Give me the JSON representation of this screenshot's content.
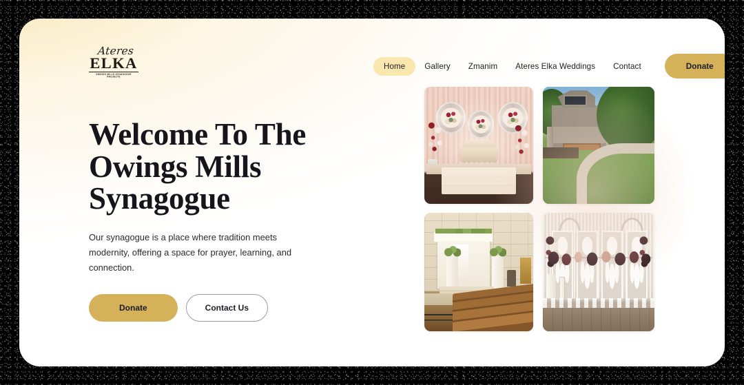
{
  "brand": {
    "script": "Ateres",
    "word": "ELKA",
    "subtitle": "OWINGS MILLS SYNAGOGUE PROJECTS"
  },
  "nav": {
    "items": [
      {
        "label": "Home",
        "active": true
      },
      {
        "label": "Gallery",
        "active": false
      },
      {
        "label": "Zmanim",
        "active": false
      },
      {
        "label": "Ateres Elka Weddings",
        "active": false
      },
      {
        "label": "Contact",
        "active": false
      }
    ],
    "donate_label": "Donate"
  },
  "hero": {
    "title": "Welcome To The Owings Mills Synagogue",
    "subtitle": "Our synagogue is a place where tradition meets modernity, offering a space for prayer, learning, and connection.",
    "primary_cta": "Donate",
    "secondary_cta": "Contact Us"
  },
  "gallery": {
    "images": [
      {
        "alt": "wedding-stage-kallah-chair"
      },
      {
        "alt": "synagogue-building-exterior"
      },
      {
        "alt": "sanctuary-interior-with-pews"
      },
      {
        "alt": "wedding-floral-backdrop"
      }
    ]
  },
  "colors": {
    "gold": "#d5b159",
    "active_pill": "#fae7b0",
    "cream": "#f7e9bf",
    "text_dark": "#15151b",
    "frame": "#000000"
  }
}
